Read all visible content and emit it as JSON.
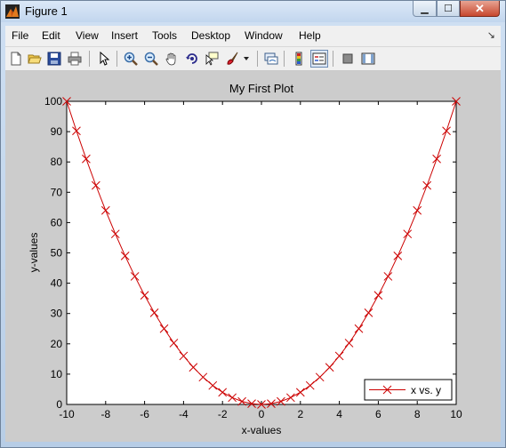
{
  "window": {
    "title": "Figure 1",
    "controls": {
      "minimize": "▁",
      "maximize": "☐",
      "close": "✕"
    }
  },
  "menu": {
    "items": [
      "File",
      "Edit",
      "View",
      "Insert",
      "Tools",
      "Desktop",
      "Window",
      "Help"
    ],
    "overflow_arrow": "↘"
  },
  "toolbar": {
    "icons": [
      "new-figure-icon",
      "open-file-icon",
      "save-icon",
      "print-icon",
      "edit-plot-arrow-icon",
      "zoom-in-icon",
      "zoom-out-icon",
      "pan-hand-icon",
      "rotate-3d-icon",
      "data-cursor-icon",
      "brush-icon",
      "brush-dropdown-icon",
      "link-plot-icon",
      "insert-colorbar-icon",
      "insert-legend-icon",
      "hide-plot-tools-icon",
      "show-plot-tools-icon"
    ]
  },
  "chart_data": {
    "type": "line",
    "title": "My First Plot",
    "xlabel": "x-values",
    "ylabel": "y-values",
    "xlim": [
      -10,
      10
    ],
    "ylim": [
      0,
      100
    ],
    "xticks": [
      -10,
      -8,
      -6,
      -4,
      -2,
      0,
      2,
      4,
      6,
      8,
      10
    ],
    "yticks": [
      0,
      10,
      20,
      30,
      40,
      50,
      60,
      70,
      80,
      90,
      100
    ],
    "grid": false,
    "legend_position": "bottom-right",
    "series": [
      {
        "name": "x vs. y",
        "color": "#cc0000",
        "marker": "x",
        "x": [
          -10,
          -9.5,
          -9,
          -8.5,
          -8,
          -7.5,
          -7,
          -6.5,
          -6,
          -5.5,
          -5,
          -4.5,
          -4,
          -3.5,
          -3,
          -2.5,
          -2,
          -1.5,
          -1,
          -0.5,
          0,
          0.5,
          1,
          1.5,
          2,
          2.5,
          3,
          3.5,
          4,
          4.5,
          5,
          5.5,
          6,
          6.5,
          7,
          7.5,
          8,
          8.5,
          9,
          9.5,
          10
        ],
        "y": [
          100,
          90.25,
          81,
          72.25,
          64,
          56.25,
          49,
          42.25,
          36,
          30.25,
          25,
          20.25,
          16,
          12.25,
          9,
          6.25,
          4,
          2.25,
          1,
          0.25,
          0,
          0.25,
          1,
          2.25,
          4,
          6.25,
          9,
          12.25,
          16,
          20.25,
          25,
          30.25,
          36,
          42.25,
          49,
          56.25,
          64,
          72.25,
          81,
          90.25,
          100
        ]
      }
    ]
  },
  "colors": {
    "figure_bg": "#cccccc",
    "axes_bg": "#ffffff",
    "series": "#cc0000"
  }
}
